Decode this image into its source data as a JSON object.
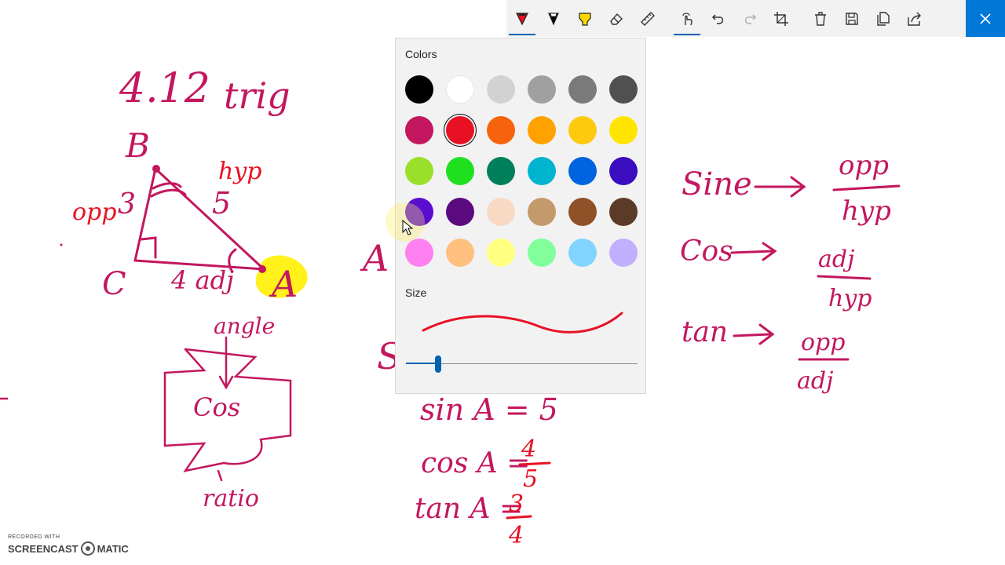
{
  "toolbar": {
    "tools": [
      {
        "id": "ballpoint-pen",
        "icon": "ballpoint-pen-icon",
        "color": "#e81123",
        "active": true
      },
      {
        "id": "pencil",
        "icon": "pencil-icon",
        "color": "#000000",
        "active": false
      },
      {
        "id": "highlighter",
        "icon": "highlighter-icon",
        "color": "#ffd800",
        "active": false
      },
      {
        "id": "eraser",
        "icon": "eraser-icon",
        "active": false
      },
      {
        "id": "ruler",
        "icon": "ruler-icon",
        "active": false
      },
      {
        "id": "touch-writing",
        "icon": "touch-writing-icon",
        "active": true
      },
      {
        "id": "undo",
        "icon": "undo-icon",
        "active": false
      },
      {
        "id": "redo",
        "icon": "redo-icon",
        "active": false,
        "disabled": true
      },
      {
        "id": "crop",
        "icon": "crop-icon",
        "active": false
      },
      {
        "id": "delete",
        "icon": "trash-icon",
        "active": false
      },
      {
        "id": "save",
        "icon": "save-icon",
        "active": false
      },
      {
        "id": "copy",
        "icon": "copy-icon",
        "active": false
      },
      {
        "id": "share",
        "icon": "share-icon",
        "active": false
      }
    ],
    "close_icon": "close-icon"
  },
  "color_panel": {
    "colors_label": "Colors",
    "size_label": "Size",
    "selected_color": "#e81123",
    "size_level": 0.14,
    "swatches": [
      [
        "#000000",
        "#ffffff",
        "#d2d2d2",
        "#a0a0a0",
        "#7a7a7a",
        "#505050"
      ],
      [
        "#c3175f",
        "#e81123",
        "#f7630c",
        "#ffa200",
        "#ffc90e",
        "#ffe500"
      ],
      [
        "#9ae02a",
        "#1ee01e",
        "#00805a",
        "#00b4d0",
        "#0063e0",
        "#3a0dbf"
      ],
      [
        "#5a0ccf",
        "#5c0a80",
        "#f7d9c4",
        "#c49a6c",
        "#8e5128",
        "#5c3a28"
      ],
      [
        "#ff80f0",
        "#ffc080",
        "#ffff80",
        "#80ff9a",
        "#80d4ff",
        "#c0b0ff"
      ]
    ]
  },
  "ink": {
    "color_magenta": "#c3175f",
    "color_red": "#e81123",
    "highlight_yellow": "#fff000",
    "title_number": "4.12",
    "title_word": "trig",
    "vertex_b": "B",
    "vertex_c": "C",
    "vertex_a": "A",
    "label_hyp": "hyp",
    "label_5": "5",
    "label_opp": "opp",
    "label_3": "3",
    "label_4adj": "4 adj",
    "label_angle": "angle",
    "label_cos_box": "Cos",
    "label_ratio": "ratio",
    "partial_mid_1": "A",
    "partial_mid_2": "S",
    "eq_sin": "sin A = 5",
    "eq_cos": "cos A =",
    "eq_cos_num": "4",
    "eq_cos_den": "5",
    "eq_tan": "tan A =",
    "eq_tan_num": "3",
    "eq_tan_den": "4",
    "right_sine": "Sine",
    "right_cos": "Cos",
    "right_tan": "tan",
    "right_opp_1": "opp",
    "right_hyp_1": "hyp",
    "right_adj_2": "adj",
    "right_hyp_2": "hyp",
    "right_opp_3": "opp",
    "right_adj_3": "adj"
  },
  "watermark": {
    "top": "RECORDED WITH",
    "left": "SCREENCAST",
    "right": "MATIC"
  }
}
